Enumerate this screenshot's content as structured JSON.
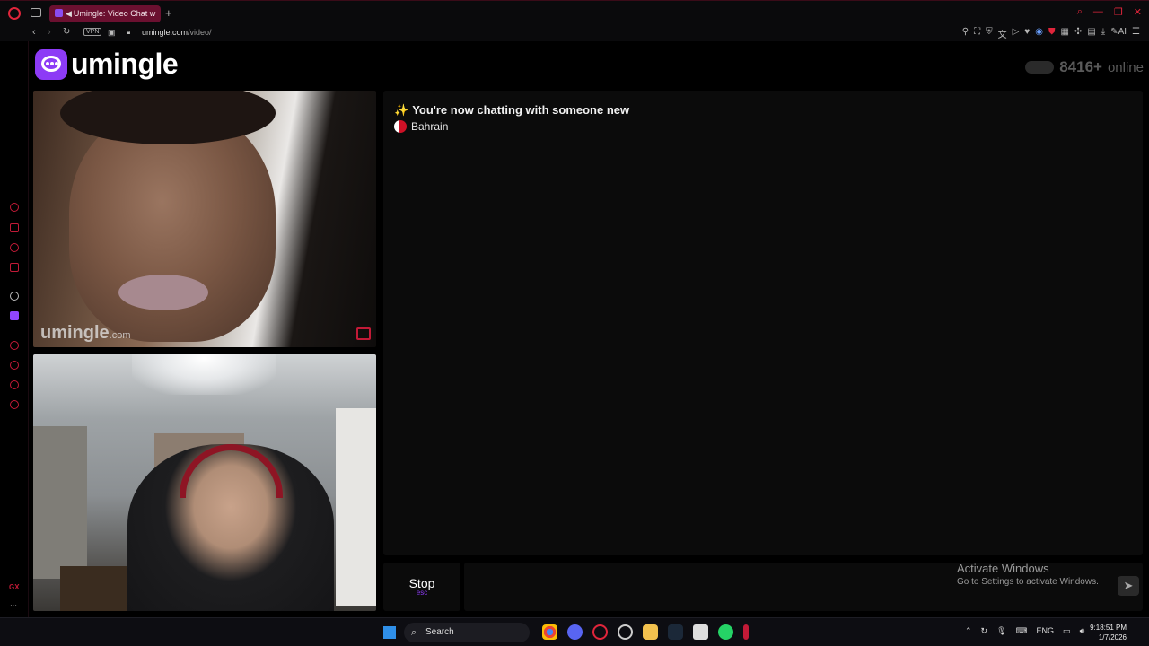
{
  "browser": {
    "tab_title": "Umingle: Video Chat w",
    "new_tab": "+",
    "vpn_badge": "VPN",
    "url_host": "umingle.com",
    "url_path": "/video/",
    "extensions": [
      "pin-icon",
      "snapshot-icon",
      "shield-icon",
      "translate-icon",
      "play-icon",
      "heart-icon",
      "vpn-icon",
      "brave-icon",
      "apps-icon",
      "puzzle-icon",
      "wallet-icon",
      "download-icon",
      "ai-icon",
      "menu-icon"
    ],
    "ai_label": "AI"
  },
  "site": {
    "logo_text": "umingle",
    "online_count": "8416+",
    "online_label": "online",
    "brand_color": "#8d3bf6"
  },
  "remote_video": {
    "watermark_main": "umingle",
    "watermark_suffix": ".com"
  },
  "chat": {
    "system_message": "You're now chatting with someone new",
    "country": "Bahrain",
    "input_placeholder": ""
  },
  "controls": {
    "stop_label": "Stop",
    "stop_shortcut": "esc"
  },
  "windows": {
    "activate_title": "Activate Windows",
    "activate_subtitle": "Go to Settings to activate Windows.",
    "search_label": "Search",
    "language": "ENG",
    "time": "9:18:51 PM",
    "date": "1/7/2026"
  }
}
